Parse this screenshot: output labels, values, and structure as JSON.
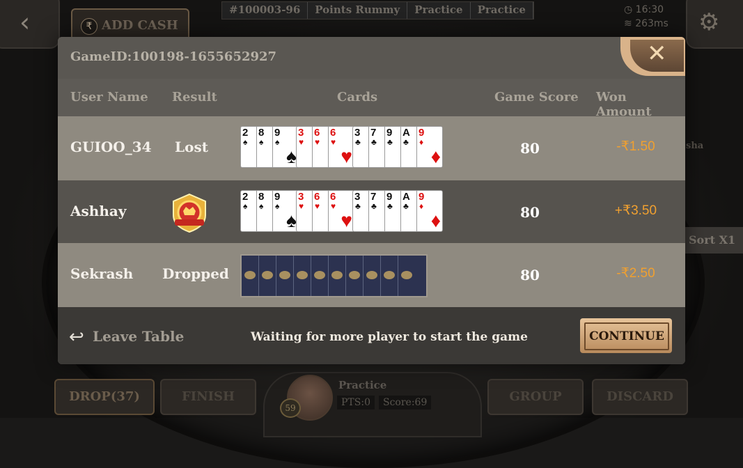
{
  "top_bar": {
    "add_cash": "ADD CASH",
    "rupee_symbol": "₹",
    "tabs": [
      "#100003-96",
      "Points Rummy",
      "Practice",
      "Practice"
    ],
    "time": "16:30",
    "ping": "263ms"
  },
  "table": {
    "sort_label": "Sort X1",
    "side_name_fragment": "sha"
  },
  "modal": {
    "game_id": "GameID:100198-1655652927",
    "columns": [
      "User Name",
      "Result",
      "Cards",
      "Game Score",
      "Won Amount"
    ],
    "rows": [
      {
        "user": "GUIOO_34",
        "result": "Lost",
        "score": "80",
        "won": "-₹1.50",
        "groups": [
          {
            "ranks": [
              "2",
              "8",
              "9"
            ],
            "suits": [
              "♠",
              "♠",
              "♠"
            ],
            "color": "black",
            "big": "♠"
          },
          {
            "ranks": [
              "3",
              "6",
              "6"
            ],
            "suits": [
              "♥",
              "♥",
              "♥"
            ],
            "color": "red",
            "big": "♥"
          },
          {
            "ranks": [
              "3",
              "7",
              "9",
              "A",
              "9"
            ],
            "suits": [
              "♣",
              "♣",
              "♣",
              "♣",
              "♦"
            ],
            "color": "mixed",
            "big": "♦"
          }
        ]
      },
      {
        "user": "Ashhay",
        "result": "",
        "result_badge": "victory-badge",
        "score": "80",
        "won": "+₹3.50",
        "groups": [
          {
            "ranks": [
              "2",
              "8",
              "9"
            ],
            "suits": [
              "♠",
              "♠",
              "♠"
            ],
            "color": "black",
            "big": "♠"
          },
          {
            "ranks": [
              "3",
              "6",
              "6"
            ],
            "suits": [
              "♥",
              "♥",
              "♥"
            ],
            "color": "red",
            "big": "♥"
          },
          {
            "ranks": [
              "3",
              "7",
              "9",
              "A",
              "9"
            ],
            "suits": [
              "♣",
              "♣",
              "♣",
              "♣",
              "♦"
            ],
            "color": "mixed",
            "big": "♦"
          }
        ]
      },
      {
        "user": "Sekrash",
        "result": "Dropped",
        "score": "80",
        "won": "-₹2.50",
        "card_backs": 10
      }
    ],
    "leave_label": "Leave Table",
    "waiting_message": "Waiting for more player to start the game",
    "continue_label": "CONTINUE"
  },
  "bottom_bar": {
    "drop": "DROP(37)",
    "finish": "FINISH",
    "group": "GROUP",
    "discard": "DISCARD",
    "player_name": "Practice",
    "pts": "PTS:0",
    "score": "Score:69",
    "level": "59"
  },
  "colors": {
    "accent_gold": "#d9b38a",
    "negative_amount": "#f0a030",
    "row_light": "#8f8a80",
    "row_dark": "#56534e"
  }
}
